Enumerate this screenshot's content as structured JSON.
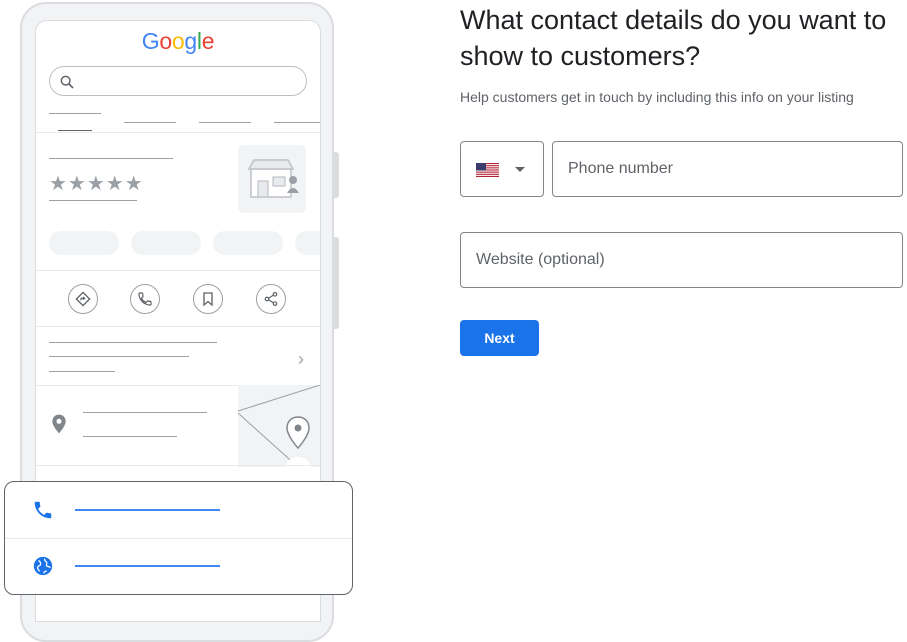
{
  "illustration": {
    "logo": "Google",
    "logo_colors": [
      "#4285f4",
      "#ea4335",
      "#fbbc05",
      "#4285f4",
      "#34a853",
      "#ea4335"
    ],
    "rating_stars": 5,
    "star_glyphs": "★★★★★",
    "action_icons": [
      "directions-icon",
      "phone-icon",
      "bookmark-icon",
      "share-icon"
    ],
    "card_icons": [
      "phone-icon",
      "globe-icon"
    ]
  },
  "form": {
    "title": "What contact details do you want to show to customers?",
    "subtitle": "Help customers get in touch by including this info on your listing",
    "country": {
      "flag": "us-flag-icon"
    },
    "phone": {
      "placeholder": "Phone number",
      "value": ""
    },
    "website": {
      "placeholder": "Website (optional)",
      "value": ""
    },
    "next_label": "Next"
  },
  "colors": {
    "accent": "#1a73e8",
    "text": "#202124",
    "muted": "#5f6368"
  }
}
